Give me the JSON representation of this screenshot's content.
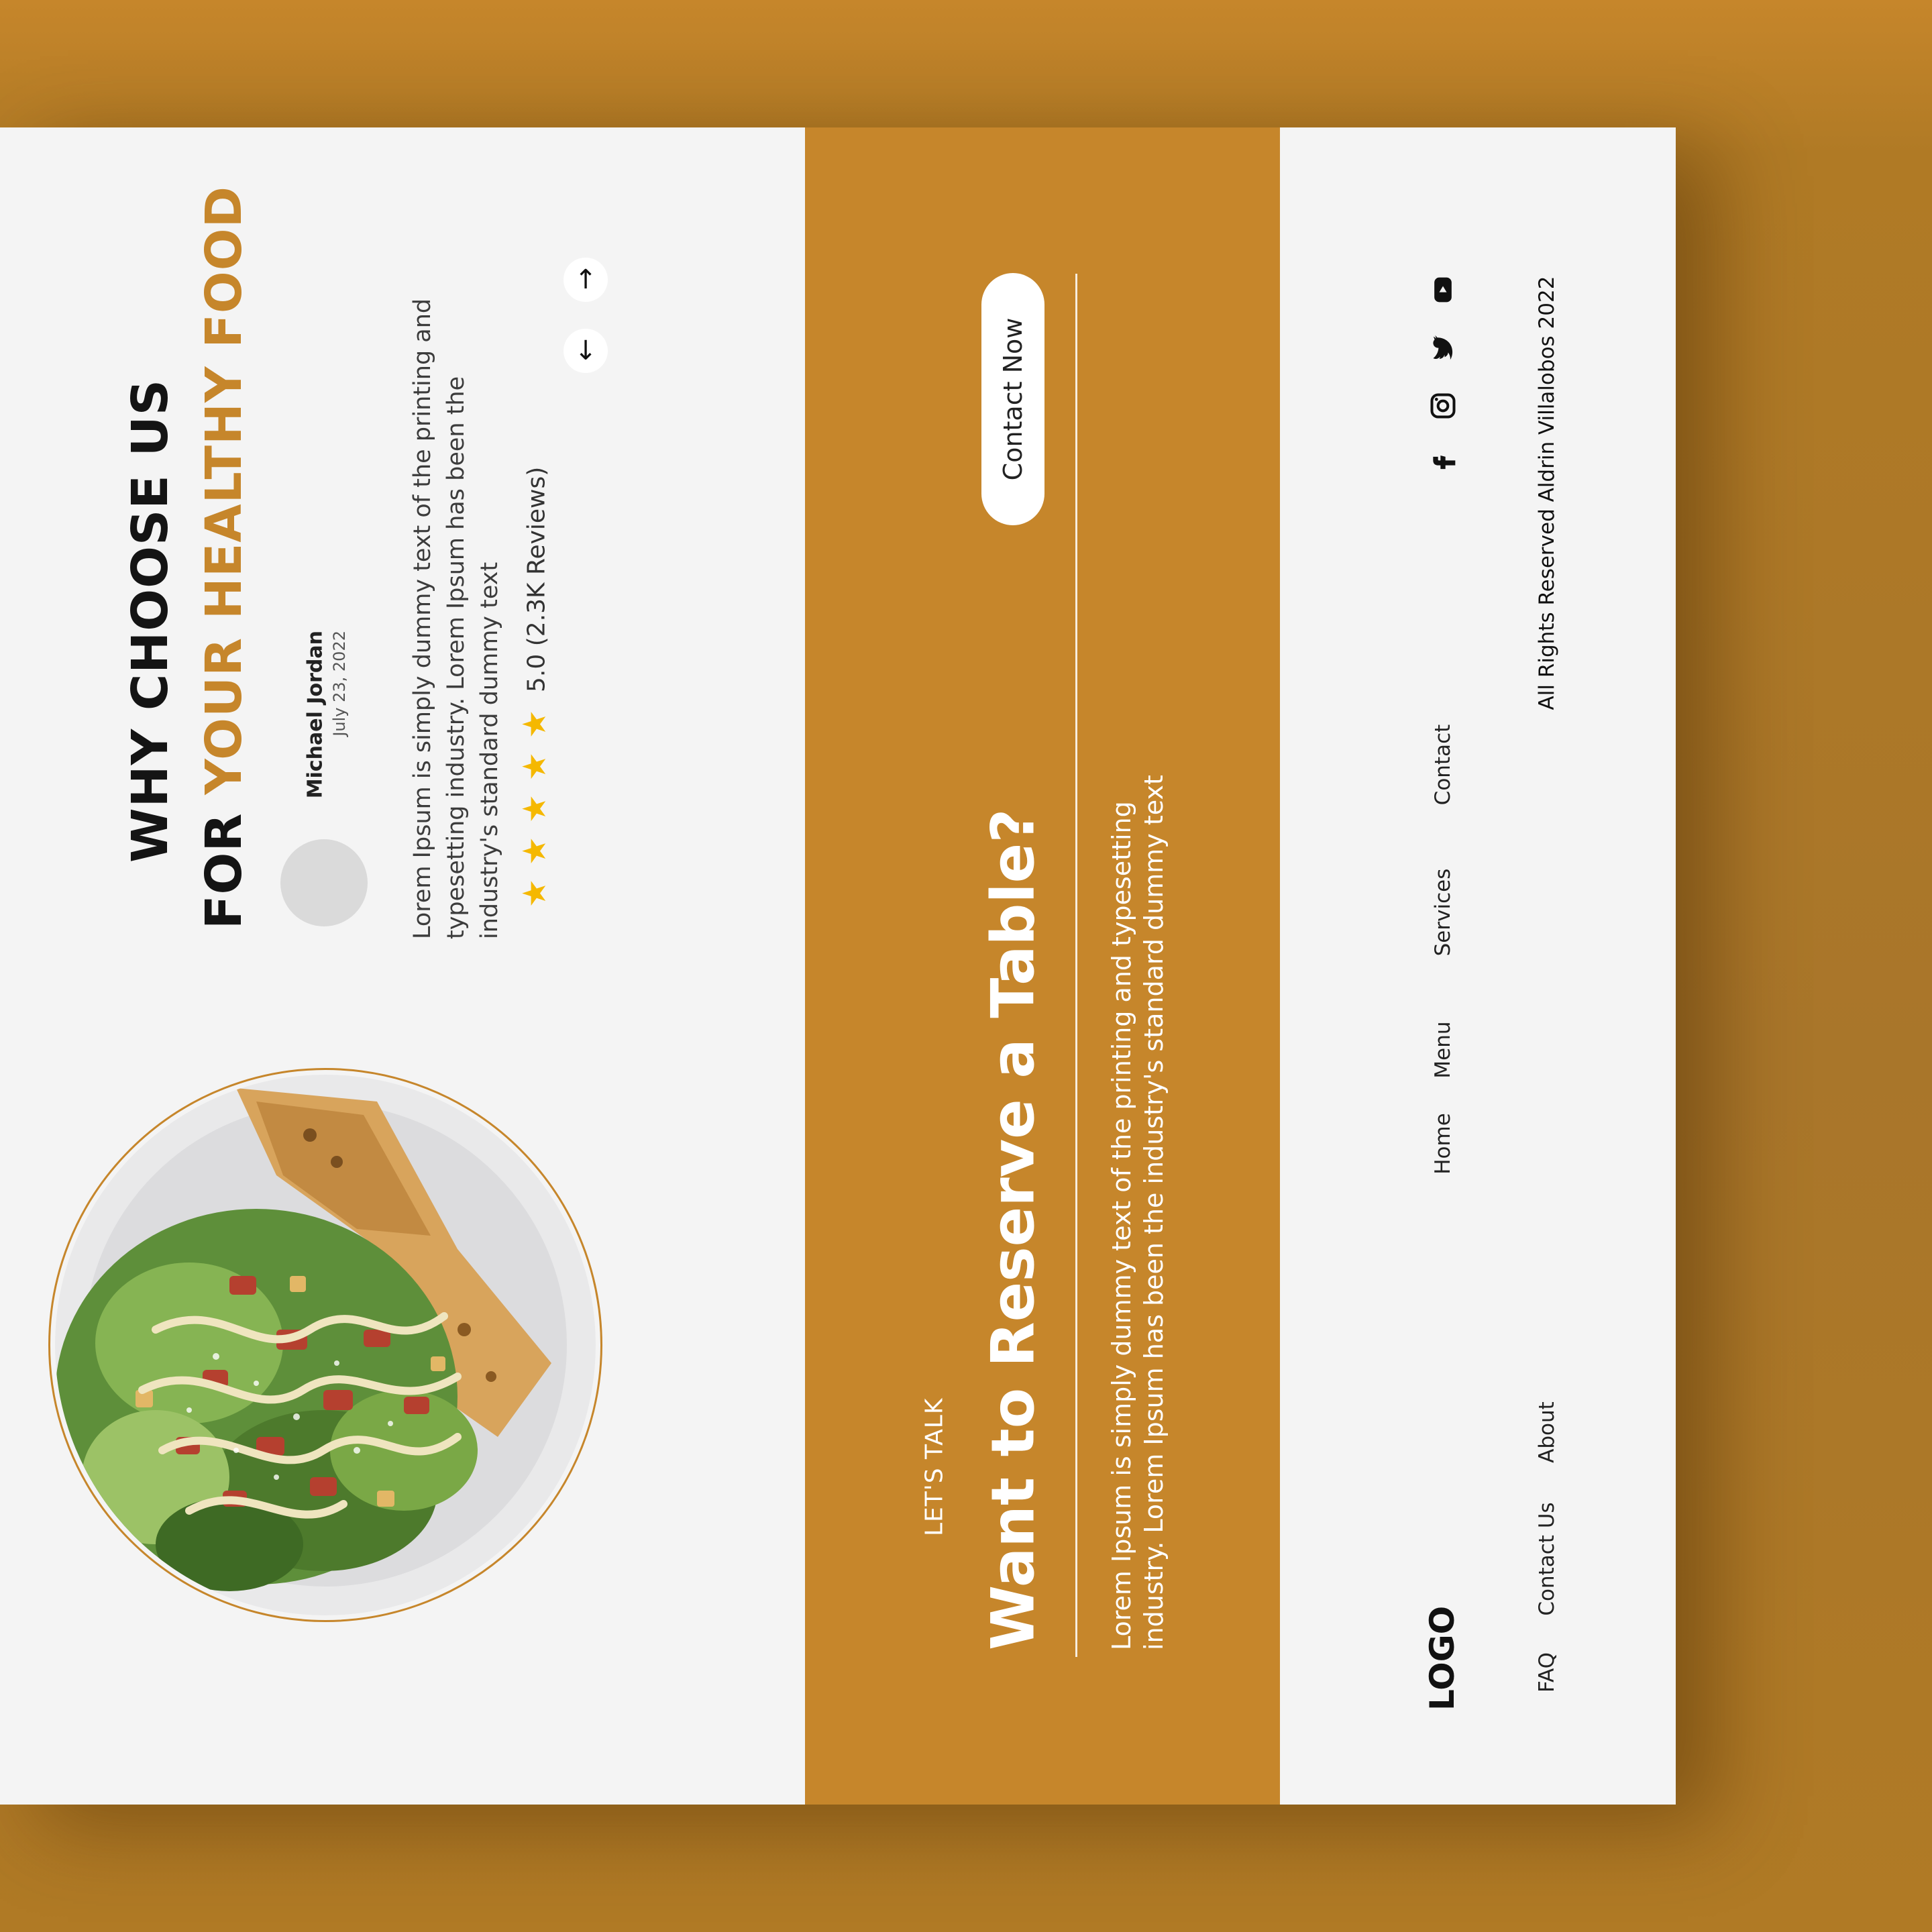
{
  "why": {
    "title_line1": "WHY CHOOSE US",
    "title_line2_prefix": "FOR ",
    "title_line2_highlight": "YOUR HEALTHY FOOD",
    "reviewer_name": "Michael Jordan",
    "review_date": "July 23, 2022",
    "review_text": "Lorem Ipsum is simply dummy text of the printing and typesetting industry. Lorem Ipsum has been the industry's standard dummy text",
    "stars": "★★★★★",
    "rating_value": 5,
    "rating_text": "5.0 (2.3K Reviews)",
    "prev_icon": "↑",
    "next_icon": "↓"
  },
  "reserve": {
    "eyebrow": "LET'S TALK",
    "title": "Want to Reserve a Table?",
    "body": "Lorem Ipsum is simply dummy text of the printing and typesetting industry. Lorem Ipsum has been the industry's standard dummy text",
    "cta": "Contact Now"
  },
  "footer": {
    "logo": "LOGO",
    "links_primary": [
      "Home",
      "Menu",
      "Services",
      "Contact"
    ],
    "links_secondary": [
      "FAQ",
      "Contact Us",
      "About"
    ],
    "social_icons": [
      "facebook-icon",
      "instagram-icon",
      "twitter-icon",
      "youtube-icon"
    ],
    "copyright": "All Rights Reserved Aldrin Villalobos 2022"
  },
  "colors": {
    "accent": "#c6862b",
    "panel_bg": "#f4f4f4",
    "star": "#f5b800"
  }
}
